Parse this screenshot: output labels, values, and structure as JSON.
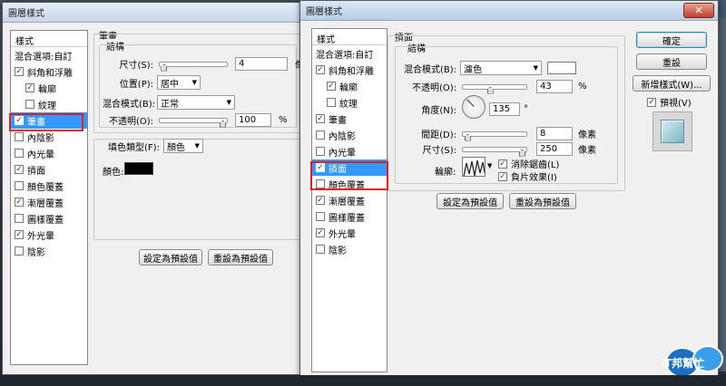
{
  "colors": {
    "selection": "#3399ff",
    "highlight": "#e02020",
    "close": "#c0402a"
  },
  "left_dialog": {
    "title": "圖層樣式",
    "styles_header": "樣式",
    "blend_options": "混合選項:自訂",
    "styles": [
      {
        "label": "斜角和浮雕",
        "checked": true,
        "indent": false,
        "selected": false
      },
      {
        "label": "輪廓",
        "checked": true,
        "indent": true,
        "selected": false
      },
      {
        "label": "紋理",
        "checked": false,
        "indent": true,
        "selected": false
      },
      {
        "label": "筆畫",
        "checked": true,
        "indent": false,
        "selected": true
      },
      {
        "label": "內陰影",
        "checked": false,
        "indent": false,
        "selected": false
      },
      {
        "label": "內光暈",
        "checked": false,
        "indent": false,
        "selected": false
      },
      {
        "label": "摃面",
        "checked": true,
        "indent": false,
        "selected": false
      },
      {
        "label": "顏色覆蓋",
        "checked": false,
        "indent": false,
        "selected": false
      },
      {
        "label": "漸層覆蓋",
        "checked": true,
        "indent": false,
        "selected": false
      },
      {
        "label": "圖樣覆蓋",
        "checked": false,
        "indent": false,
        "selected": false
      },
      {
        "label": "外光暈",
        "checked": true,
        "indent": false,
        "selected": false
      },
      {
        "label": "陰影",
        "checked": false,
        "indent": false,
        "selected": false
      }
    ],
    "section_title": "筆畫",
    "structure_title": "結構",
    "size_label": "尺寸(S):",
    "size_value": "4",
    "size_unit": "像素",
    "size_level": 0.02,
    "position_label": "位置(P):",
    "position_value": "居中",
    "blend_label": "混合模式(B):",
    "blend_value": "正常",
    "opacity_label": "不透明(O):",
    "opacity_value": "100",
    "opacity_unit": "%",
    "opacity_level": 1.0,
    "fill_type_label": "填色類型(F):",
    "fill_type_value": "顏色",
    "color_label": "顏色:",
    "color_value": "#000000",
    "set_default": "設定為預設值",
    "reset_default": "重設為預設值"
  },
  "right_dialog": {
    "title": "圖層樣式",
    "styles_header": "樣式",
    "blend_options": "混合選項:自訂",
    "styles": [
      {
        "label": "斜角和浮雕",
        "checked": true,
        "indent": false,
        "selected": false
      },
      {
        "label": "輪廓",
        "checked": true,
        "indent": true,
        "selected": false
      },
      {
        "label": "紋理",
        "checked": false,
        "indent": true,
        "selected": false
      },
      {
        "label": "筆畫",
        "checked": true,
        "indent": false,
        "selected": false
      },
      {
        "label": "內陰影",
        "checked": false,
        "indent": false,
        "selected": false
      },
      {
        "label": "內光暈",
        "checked": false,
        "indent": false,
        "selected": false
      },
      {
        "label": "摃面",
        "checked": true,
        "indent": false,
        "selected": true
      },
      {
        "label": "顏色覆蓋",
        "checked": false,
        "indent": false,
        "selected": false
      },
      {
        "label": "漸層覆蓋",
        "checked": true,
        "indent": false,
        "selected": false
      },
      {
        "label": "圖樣覆蓋",
        "checked": false,
        "indent": false,
        "selected": false
      },
      {
        "label": "外光暈",
        "checked": true,
        "indent": false,
        "selected": false
      },
      {
        "label": "陰影",
        "checked": false,
        "indent": false,
        "selected": false
      }
    ],
    "section_title": "摃面",
    "structure_title": "結構",
    "blend_label": "混合模式(B):",
    "blend_value": "濾色",
    "blend_color": "#ffffff",
    "opacity_label": "不透明(O):",
    "opacity_value": "43",
    "opacity_unit": "%",
    "opacity_level": 0.43,
    "angle_label": "角度(N):",
    "angle_value": "135",
    "angle_unit": "°",
    "distance_label": "間距(D):",
    "distance_value": "8",
    "distance_unit": "像素",
    "distance_level": 0.03,
    "size_label": "尺寸(S):",
    "size_value": "250",
    "size_unit": "像素",
    "size_level": 1.0,
    "contour_label": "輪廓:",
    "anti_alias": "消除鋸齒(L)",
    "anti_alias_checked": true,
    "invert": "負片效果(I)",
    "invert_checked": true,
    "set_default": "設定為預設值",
    "reset_default": "重設為預設值",
    "ok": "確定",
    "reset": "重設",
    "new_style": "新增樣式(W)...",
    "preview_label": "預視(V)",
    "preview_checked": true
  },
  "watermark": {
    "brand": "iT邦幫忙",
    "icon": "it-help-logo"
  }
}
